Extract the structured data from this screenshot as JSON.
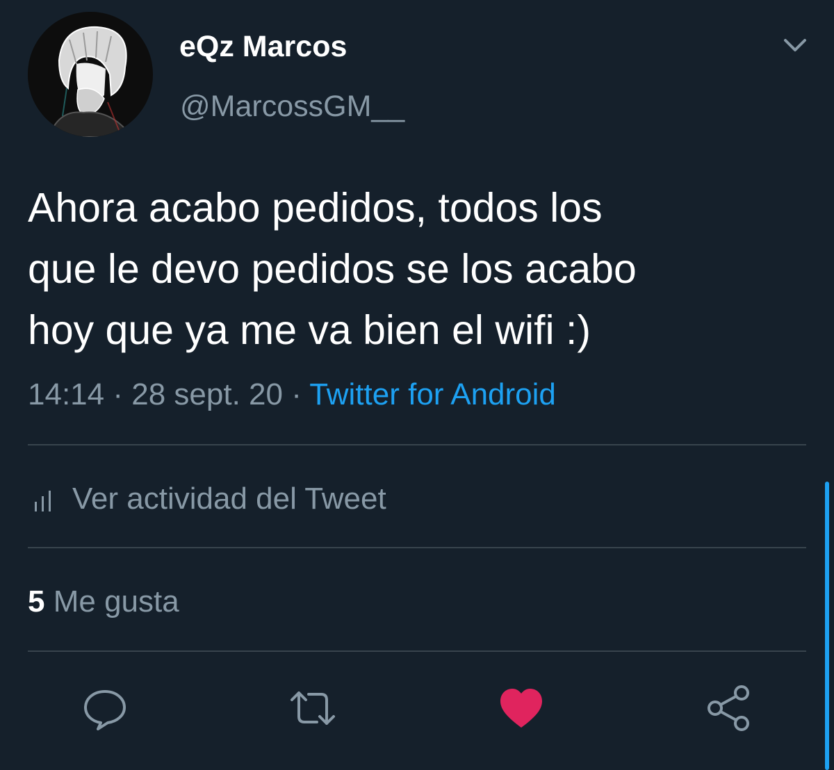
{
  "tweet": {
    "author": {
      "display_name": "eQz Marcos",
      "handle": "@MarcossGM__"
    },
    "text": "Ahora acabo pedidos, todos los\nque le devo pedidos se los acabo\nhoy que ya me va bien el wifi :)",
    "time": "14:14",
    "separator": "·",
    "date": "28 sept. 20",
    "source": "Twitter for Android"
  },
  "activity": {
    "label": "Ver actividad del Tweet"
  },
  "stats": {
    "likes_count": "5",
    "likes_label": "Me gusta"
  },
  "actions": [
    {
      "name": "reply",
      "icon": "speech-bubble-icon"
    },
    {
      "name": "retweet",
      "icon": "retweet-icon"
    },
    {
      "name": "like",
      "icon": "heart-icon",
      "active": true
    },
    {
      "name": "share",
      "icon": "share-icon"
    }
  ],
  "colors": {
    "background": "#15202b",
    "text_primary": "#ffffff",
    "text_secondary": "#8899a6",
    "link": "#1da1f2",
    "like_active": "#e0245e",
    "divider": "#38444d"
  }
}
